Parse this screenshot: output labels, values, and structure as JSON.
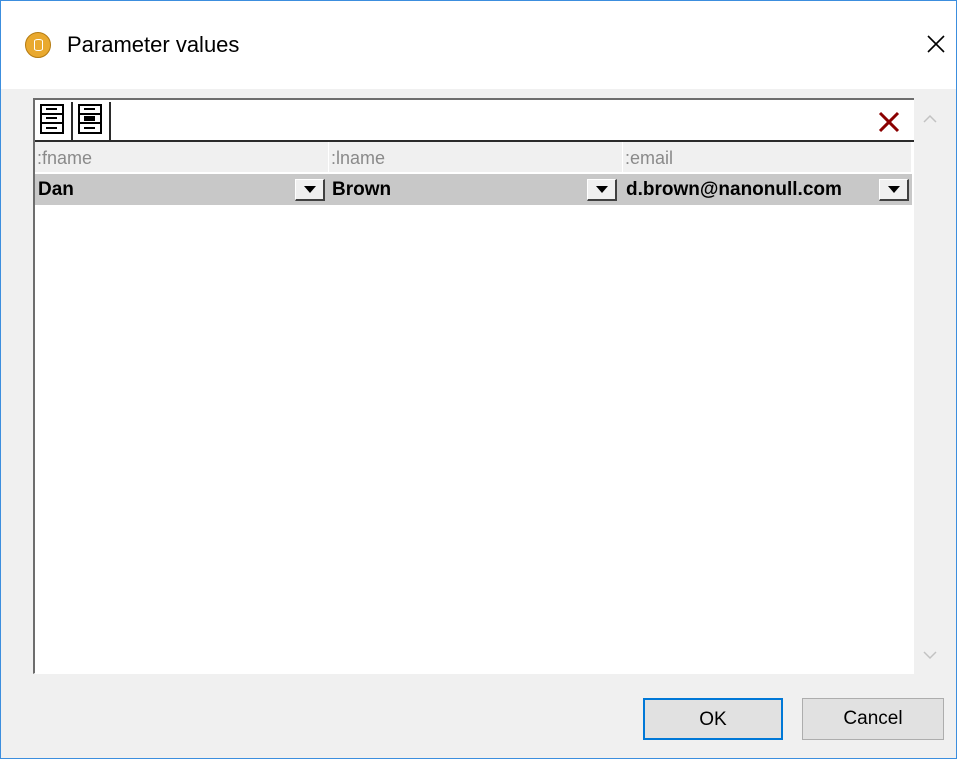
{
  "window": {
    "title": "Parameter values",
    "title_icon": "database-cylinder-icon",
    "close_icon": "close-icon"
  },
  "toolbar": {
    "buttons": [
      {
        "icon": "append-row-icon"
      },
      {
        "icon": "insert-row-icon"
      }
    ],
    "delete_icon": "delete-row-icon",
    "delete_color": "#8b0000"
  },
  "grid": {
    "columns": [
      ":fname",
      ":lname",
      ":email"
    ],
    "rows": [
      {
        "fname": "Dan",
        "lname": "Brown",
        "email": "d.brown@nanonull.com"
      }
    ],
    "selected_row_color": "#c8c8c8"
  },
  "buttons": {
    "ok_label": "OK",
    "cancel_label": "Cancel",
    "focus_color": "#0078d7"
  }
}
